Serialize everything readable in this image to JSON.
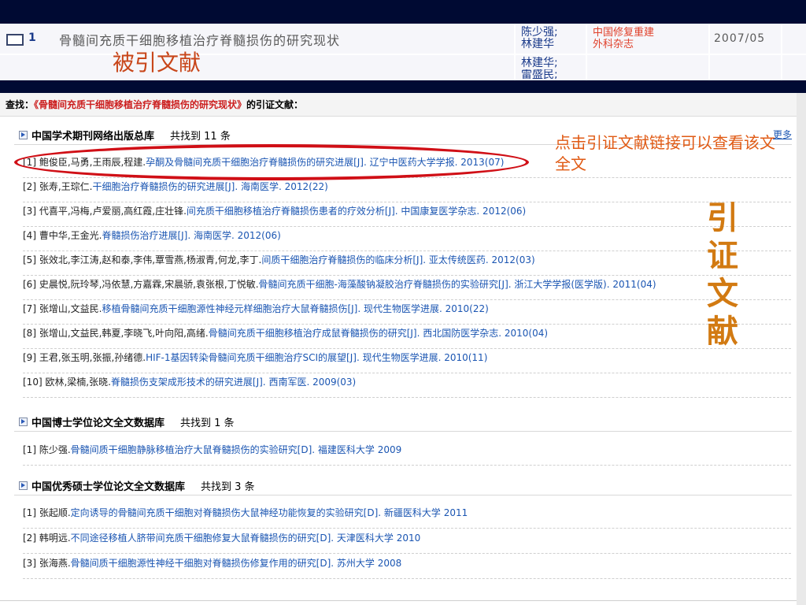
{
  "header": {
    "num": "1",
    "title": "骨髓间充质干细胞移植治疗脊髓损伤的研究现状",
    "authors_line1": "陈少强;",
    "authors_line2": "林建华",
    "journal_line1": "中国修复重建",
    "journal_line2": "外科杂志",
    "date": "2007/05",
    "authors_row2_line1": "林建华;",
    "authors_row2_line2": "雷盛民;"
  },
  "annotations": {
    "cited_doc": "被引文献",
    "click_hint": "点击引证文献链接可以查看该文全文",
    "citing_vertical": "引证文献"
  },
  "search": {
    "label": "查找：",
    "query": "《骨髓间充质干细胞移植治疗脊髓损伤的研究现状》",
    "suffix": "的引证文献："
  },
  "sections": [
    {
      "title": "中国学术期刊网络出版总库",
      "count": "共找到 11 条",
      "more": "更多",
      "items": [
        {
          "prefix": "[1] 鲍俊臣,马勇,王雨辰,程建.",
          "title": "孕酮及骨髓间充质干细胞治疗脊髓损伤的研究进展[J]. 辽宁中医药大学学报. 2013(07)",
          "suffix": ""
        },
        {
          "prefix": "[2] 张寿,王琮仁.",
          "title": "干细胞治疗脊髓损伤的研究进展[J]. 海南医学. 2012(22)",
          "suffix": ""
        },
        {
          "prefix": "[3] 代喜平,冯梅,卢爱丽,高红霞,庄壮锋.",
          "title": "间充质干细胞移植治疗脊髓损伤患者的疗效分析[J]. 中国康复医学杂志. 2012(06)",
          "suffix": ""
        },
        {
          "prefix": "[4] 曹中华,王金光.",
          "title": "脊髓损伤治疗进展[J]. 海南医学. 2012(06)",
          "suffix": ""
        },
        {
          "prefix": "[5] 张效北,李江涛,赵和泰,李伟,覃雪燕,杨淑青,何龙,李丁.",
          "title": "间质干细胞治疗脊髓损伤的临床分析[J]. 亚太传统医药. 2012(03)",
          "suffix": ""
        },
        {
          "prefix": "[6] 史晨悦,阮玲琴,冯依慧,方嘉霖,宋晨骄,袁张根,丁悦敏.",
          "title": "骨髓间充质干细胞-海藻酸钠凝胶治疗脊髓损伤的实验研究[J]. 浙江大学学报(医学版). 2011(04)",
          "suffix": ""
        },
        {
          "prefix": "[7] 张增山,文益民.",
          "title": "移植骨髓间充质干细胞源性神经元样细胞治疗大鼠脊髓损伤[J]. 现代生物医学进展. 2010(22)",
          "suffix": ""
        },
        {
          "prefix": "[8] 张增山,文益民,韩夏,李晓飞,叶向阳,高绪.",
          "title": "骨髓间充质干细胞移植治疗成鼠脊髓损伤的研究[J]. 西北国防医学杂志. 2010(04)",
          "suffix": ""
        },
        {
          "prefix": "[9] 王君,张玉明,张振,孙绪德.",
          "title": "HIF-1基因转染骨髓间充质干细胞治疗SCI的展望[J]. 现代生物医学进展. 2010(11)",
          "suffix": ""
        },
        {
          "prefix": "[10] 欧林,梁楠,张晓.",
          "title": "脊髓损伤支架成形技术的研究进展[J]. 西南军医. 2009(03)",
          "suffix": ""
        }
      ]
    },
    {
      "title": "中国博士学位论文全文数据库",
      "count": "共找到 1 条",
      "items": [
        {
          "prefix": "[1] 陈少强.",
          "title": "骨髓间质干细胞静脉移植治疗大鼠脊髓损伤的实验研究[D]. 福建医科大学 2009",
          "suffix": ""
        }
      ]
    },
    {
      "title": "中国优秀硕士学位论文全文数据库",
      "count": "共找到 3 条",
      "items": [
        {
          "prefix": "[1] 张起顺.",
          "title": "定向诱导的骨髓间充质干细胞对脊髓损伤大鼠神经功能恢复的实验研究[D]. 新疆医科大学 2011",
          "suffix": ""
        },
        {
          "prefix": "[2] 韩明远.",
          "title": "不同途径移植人脐带间充质干细胞修复大鼠脊髓损伤的研究[D]. 天津医科大学 2010",
          "suffix": ""
        },
        {
          "prefix": "[3] 张海燕.",
          "title": "骨髓间质干细胞源性神经干细胞对脊髓损伤修复作用的研究[D]. 苏州大学 2008",
          "suffix": ""
        }
      ]
    }
  ]
}
